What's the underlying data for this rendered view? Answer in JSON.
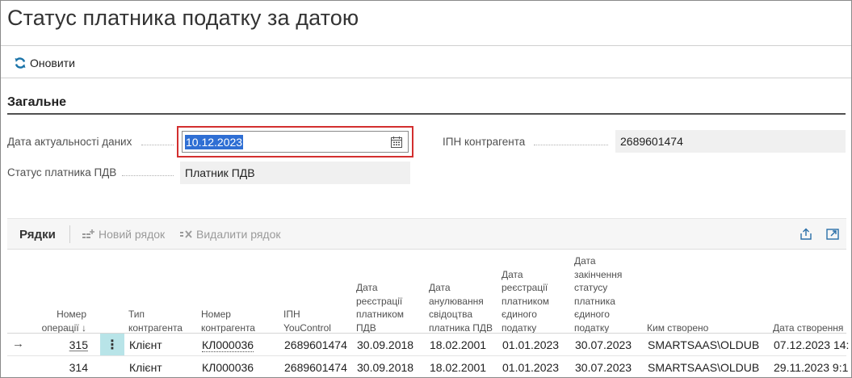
{
  "page": {
    "title": "Статус платника податку за датою"
  },
  "toolbar": {
    "refresh_label": "Оновити"
  },
  "section": {
    "title": "Загальне"
  },
  "fields": {
    "date_label": "Дата актуальності даних",
    "date_value": "10.12.2023",
    "ipn_label": "ІПН контрагента",
    "ipn_value": "2689601474",
    "status_label": "Статус платника ПДВ",
    "status_value": "Платник ПДВ"
  },
  "rows_part": {
    "title": "Рядки",
    "new_row_label": "Новий рядок",
    "delete_row_label": "Видалити рядок"
  },
  "table": {
    "columns": [
      "Номер операції ↓",
      "Тип контрагента",
      "Номер контрагента",
      "ІПН YouControl",
      "Дата реєстрації платником ПДВ",
      "Дата анулювання свідоцтва платника ПДВ",
      "Дата реєстрації платником єдиного податку",
      "Дата закінчення статусу платника єдиного податку",
      "Ким створено",
      "Дата створення"
    ],
    "rows": [
      [
        "315",
        "Клієнт",
        "КЛ000036",
        "2689601474",
        "30.09.2018",
        "18.02.2001",
        "01.01.2023",
        "30.07.2023",
        "SMARTSAAS\\OLDUB",
        "07.12.2023 14:"
      ],
      [
        "314",
        "Клієнт",
        "КЛ000036",
        "2689601474",
        "30.09.2018",
        "18.02.2001",
        "01.01.2023",
        "30.07.2023",
        "SMARTSAAS\\OLDUB",
        "29.11.2023 9:1"
      ]
    ]
  },
  "colors": {
    "accent": "#2f6fd4",
    "focus_border": "#d32f2f",
    "selected_row_cell": "#b8e4e8"
  }
}
